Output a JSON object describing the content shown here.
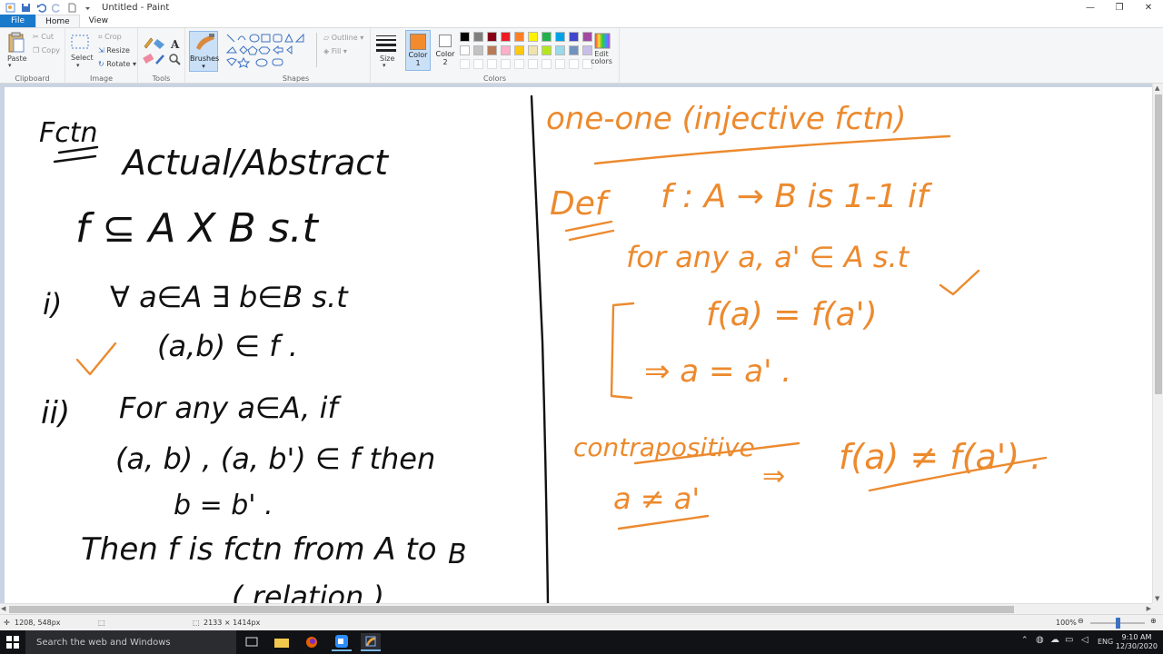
{
  "window": {
    "title": "Untitled - Paint"
  },
  "menu": {
    "file": "File",
    "home": "Home",
    "view": "View"
  },
  "ribbon": {
    "clipboard": {
      "paste": "Paste",
      "cut": "Cut",
      "copy": "Copy",
      "label": "Clipboard"
    },
    "image": {
      "select": "Select",
      "crop": "Crop",
      "resize": "Resize",
      "rotate": "Rotate",
      "label": "Image"
    },
    "tools": {
      "label": "Tools"
    },
    "brushes": {
      "label": "Brushes"
    },
    "shapes": {
      "outline": "Outline",
      "fill": "Fill",
      "label": "Shapes"
    },
    "size": {
      "label": "Size"
    },
    "colors": {
      "color1": "Color 1",
      "color2": "Color 2",
      "edit": "Edit colors",
      "label": "Colors",
      "color1_value": "#f28b2c",
      "color2_value": "#ffffff",
      "palette_row1": [
        "#000000",
        "#7f7f7f",
        "#880015",
        "#ed1c24",
        "#ff7f27",
        "#fff200",
        "#22b14c",
        "#00a2e8",
        "#3f48cc",
        "#a349a4"
      ],
      "palette_row2": [
        "#ffffff",
        "#c3c3c3",
        "#b97a57",
        "#ffaec9",
        "#ffc90e",
        "#efe4b0",
        "#b5e61d",
        "#99d9ea",
        "#7092be",
        "#c8bfe7"
      ]
    }
  },
  "canvas_notes": {
    "left": {
      "heading": "Fctn",
      "subheading": "Actual/Abstract",
      "defn": "f ⊆ A X B    s.t",
      "cond1_num": "i)",
      "cond1": "∀ a∈A  ∃ b∈B  s.t",
      "cond1b": "(a,b) ∈ f .",
      "cond2_num": "ii)",
      "cond2": "For any a∈A, if",
      "cond2b": "(a, b) , (a, b') ∈ f  then",
      "cond2c": "b = b' .",
      "then": "Then  f is fctn  from A to",
      "then_b": "B",
      "bottom": "( relation )"
    },
    "right": {
      "heading": "one-one (injective fctn)",
      "def_label": "Def",
      "def": "f : A → B  is  1-1  if",
      "forany": "for  any   a, a' ∈ A   s.t",
      "eq1": "f(a) = f(a')",
      "eq2": "⇒    a = a' .",
      "contra": "contrapositive",
      "neq1": "f(a)  ≠  f(a') .",
      "neq2": "a ≠ a'",
      "implies": "⇒"
    }
  },
  "status": {
    "cursor": "1208, 548px",
    "dimensions": "2133 × 1414px",
    "zoom": "100%"
  },
  "taskbar": {
    "search_placeholder": "Search the web and Windows",
    "lang": "ENG",
    "time": "9:10 AM",
    "date": "12/30/2020"
  }
}
